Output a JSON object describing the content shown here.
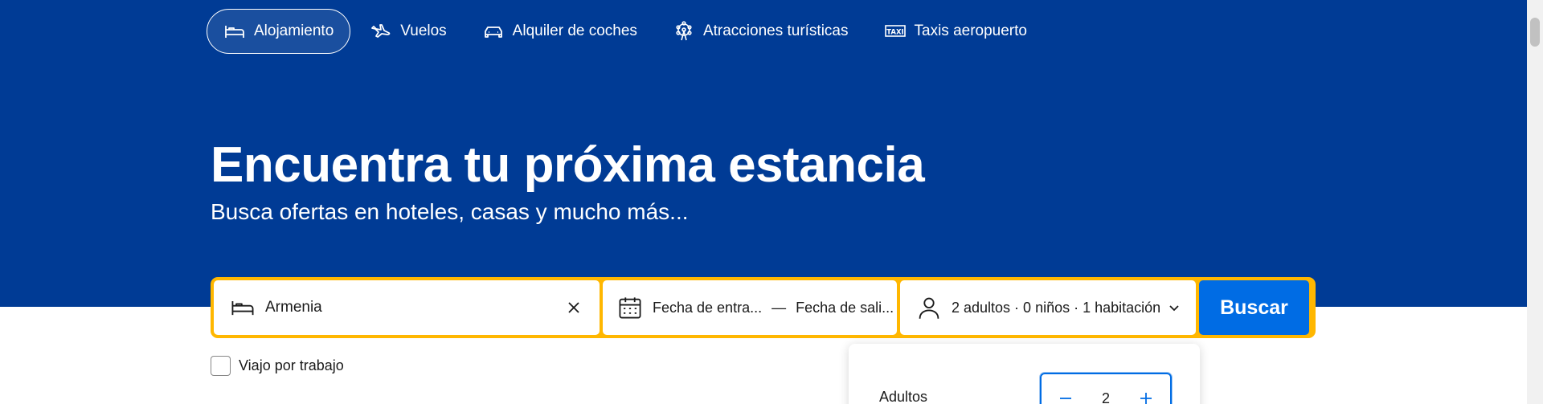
{
  "nav": {
    "items": [
      {
        "label": "Alojamiento",
        "icon": "bed-icon",
        "active": true
      },
      {
        "label": "Vuelos",
        "icon": "plane-icon"
      },
      {
        "label": "Alquiler de coches",
        "icon": "car-icon"
      },
      {
        "label": "Atracciones turísticas",
        "icon": "ferris-wheel-icon"
      },
      {
        "label": "Taxis aeropuerto",
        "icon": "taxi-icon",
        "icon_text": "TAXI"
      }
    ]
  },
  "hero": {
    "title": "Encuentra tu próxima estancia",
    "subtitle": "Busca ofertas en hoteles, casas y mucho más..."
  },
  "search": {
    "destination_value": "Armenia",
    "checkin_placeholder": "Fecha de entra...",
    "date_separator": "—",
    "checkout_placeholder": "Fecha de sali...",
    "guests_summary": "2 adultos · 0 niños · 1 habitación",
    "submit_label": "Buscar"
  },
  "work_trip": {
    "label": "Viajo por trabajo",
    "checked": false
  },
  "guests_popup": {
    "adults_label": "Adultos",
    "adults_value": "2"
  },
  "colors": {
    "brand_blue": "#003b95",
    "accent_yellow": "#ffb700",
    "button_blue": "#006ce4"
  }
}
